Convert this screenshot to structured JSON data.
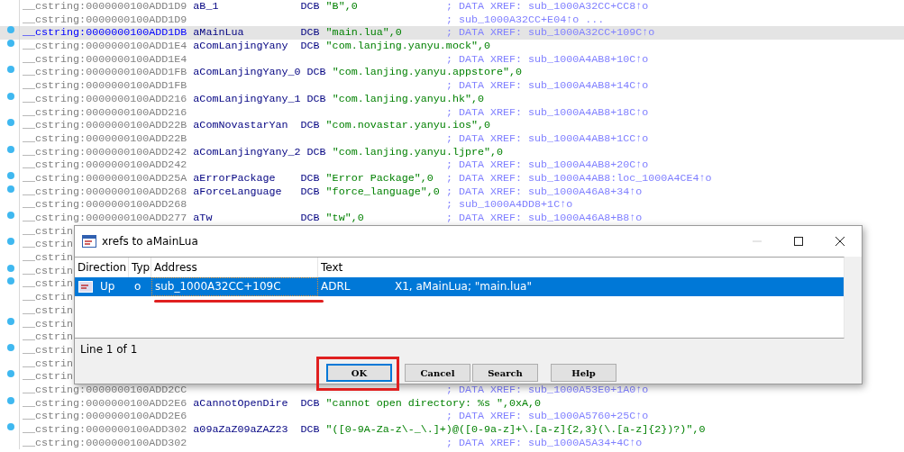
{
  "listing": {
    "rows": [
      {
        "address": "__cstring:0000000100ADD1D9",
        "name": "aB_1",
        "directive": "DCB",
        "operand": "\"B\",0",
        "comment": "; DATA XREF: sub_1000A32CC+CC8↑o",
        "marked": false,
        "selected": false
      },
      {
        "address": "__cstring:0000000100ADD1D9",
        "comment": "; sub_1000A32CC+E04↑o ...",
        "marked": false,
        "selected": false
      },
      {
        "address": "__cstring:0000000100ADD1DB",
        "name": "aMainLua",
        "directive": "DCB",
        "operand": "\"main.lua\",0",
        "comment": "; DATA XREF: sub_1000A32CC+109C↑o",
        "marked": true,
        "selected": true
      },
      {
        "address": "__cstring:0000000100ADD1E4",
        "name": "aComLanjingYany",
        "directive": "DCB",
        "operand": "\"com.lanjing.yanyu.mock\",0",
        "marked": true,
        "selected": false
      },
      {
        "address": "__cstring:0000000100ADD1E4",
        "comment": "; DATA XREF: sub_1000A4AB8+10C↑o",
        "marked": false,
        "selected": false
      },
      {
        "address": "__cstring:0000000100ADD1FB",
        "name": "aComLanjingYany_0",
        "directive": "DCB",
        "operand": "\"com.lanjing.yanyu.appstore\",0",
        "marked": true,
        "selected": false
      },
      {
        "address": "__cstring:0000000100ADD1FB",
        "comment": "; DATA XREF: sub_1000A4AB8+14C↑o",
        "marked": false,
        "selected": false
      },
      {
        "address": "__cstring:0000000100ADD216",
        "name": "aComLanjingYany_1",
        "directive": "DCB",
        "operand": "\"com.lanjing.yanyu.hk\",0",
        "marked": true,
        "selected": false
      },
      {
        "address": "__cstring:0000000100ADD216",
        "comment": "; DATA XREF: sub_1000A4AB8+18C↑o",
        "marked": false,
        "selected": false
      },
      {
        "address": "__cstring:0000000100ADD22B",
        "name": "aComNovastarYan",
        "directive": "DCB",
        "operand": "\"com.novastar.yanyu.ios\",0",
        "marked": true,
        "selected": false
      },
      {
        "address": "__cstring:0000000100ADD22B",
        "comment": "; DATA XREF: sub_1000A4AB8+1CC↑o",
        "marked": false,
        "selected": false
      },
      {
        "address": "__cstring:0000000100ADD242",
        "name": "aComLanjingYany_2",
        "directive": "DCB",
        "operand": "\"com.lanjing.yanyu.ljpre\",0",
        "marked": true,
        "selected": false
      },
      {
        "address": "__cstring:0000000100ADD242",
        "comment": "; DATA XREF: sub_1000A4AB8+20C↑o",
        "marked": false,
        "selected": false
      },
      {
        "address": "__cstring:0000000100ADD25A",
        "name": "aErrorPackage",
        "directive": "DCB",
        "operand": "\"Error Package\",0",
        "comment": "; DATA XREF: sub_1000A4AB8:loc_1000A4CE4↑o",
        "marked": true,
        "selected": false
      },
      {
        "address": "__cstring:0000000100ADD268",
        "name": "aForceLanguage",
        "directive": "DCB",
        "operand": "\"force_language\",0",
        "comment": "; DATA XREF: sub_1000A46A8+34↑o",
        "marked": true,
        "selected": false
      },
      {
        "address": "__cstring:0000000100ADD268",
        "comment": "; sub_1000A4DD8+1C↑o",
        "marked": false,
        "selected": false
      },
      {
        "address": "__cstring:0000000100ADD277",
        "name": "aTw",
        "directive": "DCB",
        "operand": "\"tw\",0",
        "comment": "; DATA XREF: sub_1000A46A8+B8↑o",
        "marked": true,
        "selected": false
      },
      {
        "address": "__cstrin",
        "marked": false,
        "selected": false
      },
      {
        "address": "__cstrin",
        "marked": true,
        "selected": false
      },
      {
        "address": "__cstrin",
        "marked": false,
        "selected": false
      },
      {
        "address": "__cstrin",
        "marked": true,
        "selected": false
      },
      {
        "address": "__cstrin",
        "marked": true,
        "selected": false
      },
      {
        "address": "__cstrin",
        "marked": false,
        "selected": false
      },
      {
        "address": "__cstrin",
        "marked": false,
        "selected": false
      },
      {
        "address": "__cstrin",
        "marked": true,
        "selected": false
      },
      {
        "address": "__cstrin",
        "marked": false,
        "selected": false
      },
      {
        "address": "__cstrin",
        "marked": true,
        "selected": false
      },
      {
        "address": "__cstrin",
        "marked": false,
        "selected": false
      },
      {
        "address": "__cstrin",
        "marked": true,
        "selected": false
      },
      {
        "address": "__cstring:0000000100ADD2CC",
        "comment": "; DATA XREF: sub_1000A53E0+1A0↑o",
        "marked": false,
        "selected": false
      },
      {
        "address": "__cstring:0000000100ADD2E6",
        "name": "aCannotOpenDire",
        "directive": "DCB",
        "operand": "\"cannot open directory: %s \",0xA,0",
        "marked": true,
        "selected": false
      },
      {
        "address": "__cstring:0000000100ADD2E6",
        "comment": "; DATA XREF: sub_1000A5760+25C↑o",
        "marked": false,
        "selected": false
      },
      {
        "address": "__cstring:0000000100ADD302",
        "name": "a09aZaZ09aZAZ23",
        "directive": "DCB",
        "operand": "\"([0-9A-Za-z\\-_\\.]+)@([0-9a-z]+\\.[a-z]{2,3}(\\.[a-z]{2})?)\",0",
        "marked": true,
        "selected": false
      },
      {
        "address": "__cstring:0000000100ADD302",
        "comment": "; DATA XREF: sub_1000A5A34+4C↑o",
        "marked": false,
        "selected": false
      }
    ]
  },
  "dialog": {
    "title": "xrefs to aMainLua",
    "columns": [
      "Direction",
      "Typ",
      "Address",
      "Text"
    ],
    "rows": [
      {
        "direction": "Up",
        "type": "o",
        "address": "sub_1000A32CC+109C",
        "instruction": "ADRL",
        "operands": "X1, aMainLua; \"main.lua\"",
        "selected": true
      }
    ],
    "status": "Line 1 of 1",
    "buttons": [
      {
        "label": "OK",
        "focused": true
      },
      {
        "label": "Cancel",
        "focused": false
      },
      {
        "label": "Search",
        "focused": false
      },
      {
        "label": "Help",
        "focused": false
      }
    ]
  }
}
